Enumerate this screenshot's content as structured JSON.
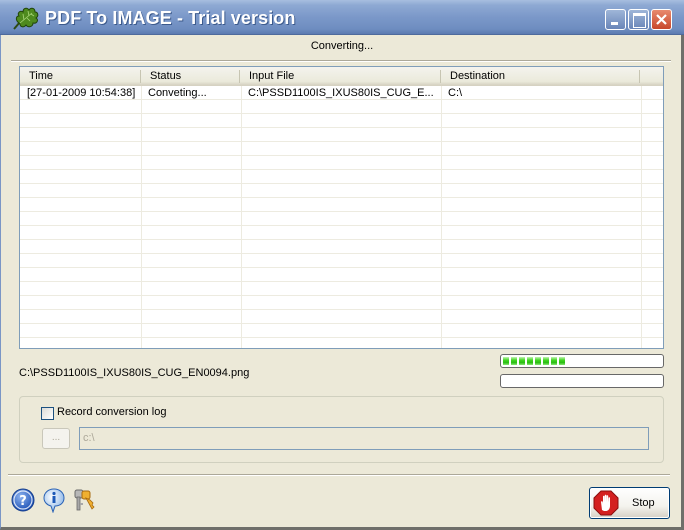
{
  "window": {
    "title": "PDF To IMAGE - Trial version",
    "controls": {
      "minimize": "minimize",
      "maximize": "maximize",
      "close": "close"
    }
  },
  "status_text": "Converting...",
  "log_table": {
    "columns": [
      "Time",
      "Status",
      "Input File",
      "Destination"
    ],
    "rows": [
      {
        "time": "[27-01-2009 10:54:38]",
        "status": "Conveting...",
        "input_file": "C:\\PSSD1100IS_IXUS80IS_CUG_E...",
        "destination": "C:\\"
      }
    ],
    "empty_rows": 17
  },
  "current_file": "C:\\PSSD1100IS_IXUS80IS_CUG_EN0094.png",
  "progress": {
    "file_progress_segments": 8,
    "file_progress_percent": 38,
    "total_progress_percent": 0
  },
  "log_options": {
    "checkbox_label": "Record conversion log",
    "checked": false,
    "browse_label": "...",
    "path_value": "c:\\"
  },
  "footer": {
    "icons": [
      "help-icon",
      "info-icon",
      "keys-icon"
    ],
    "stop_label": "Stop"
  },
  "colors": {
    "titlebar": "#7B98C9",
    "progress_fill": "#40D520",
    "stop_red": "#D42020",
    "dialog_bg": "#ECE9D8"
  }
}
